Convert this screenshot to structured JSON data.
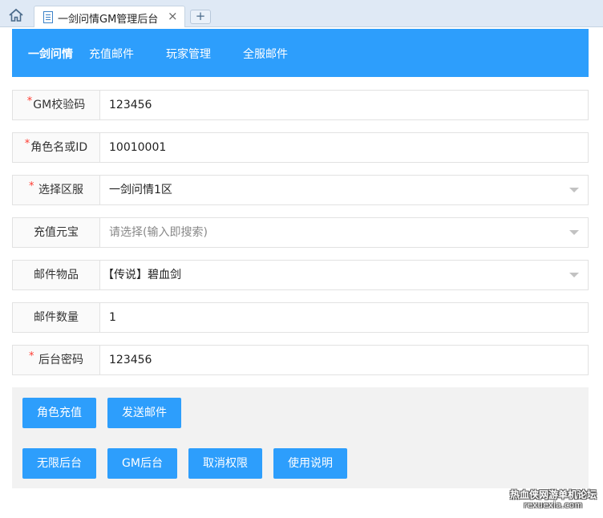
{
  "browser": {
    "tab_title": "一剑问情GM管理后台",
    "close_glyph": "×",
    "newtab_glyph": "+"
  },
  "nav": {
    "brand": "一剑问情",
    "items": [
      "充值邮件",
      "玩家管理",
      "全服邮件"
    ]
  },
  "form": {
    "rows": [
      {
        "label": "GM校验码",
        "required": true,
        "value": "123456",
        "type": "input"
      },
      {
        "label": "角色名或ID",
        "required": true,
        "value": "10010001",
        "type": "input"
      },
      {
        "label": "选择区服",
        "required": true,
        "value": "一剑问情1区",
        "type": "select"
      },
      {
        "label": "充值元宝",
        "required": false,
        "placeholder": "请选择(输入即搜索)",
        "type": "select"
      },
      {
        "label": "邮件物品",
        "required": false,
        "value": "【传说】碧血剑",
        "type": "select"
      },
      {
        "label": "邮件数量",
        "required": false,
        "value": "1",
        "type": "input"
      },
      {
        "label": "后台密码",
        "required": true,
        "value": "123456",
        "type": "input"
      }
    ],
    "required_mark": "*"
  },
  "actions": {
    "row1": [
      "角色充值",
      "发送邮件"
    ],
    "row2": [
      "无限后台",
      "GM后台",
      "取消权限",
      "使用说明"
    ]
  },
  "watermark": {
    "main": "热血侠网游单机论坛",
    "sub": "rexuexia.com"
  },
  "colors": {
    "accent": "#2d9efc",
    "required": "#ff3b30"
  }
}
